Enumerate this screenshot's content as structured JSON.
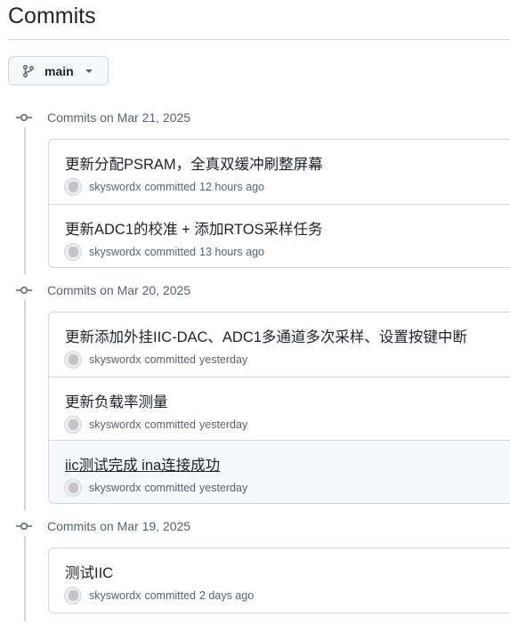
{
  "page": {
    "title": "Commits"
  },
  "branch": {
    "label": "main"
  },
  "groups": [
    {
      "label": "Commits on Mar 21, 2025",
      "commits": [
        {
          "title": "更新分配PSRAM，全真双缓冲刷整屏幕",
          "author": "skyswordx",
          "action": "committed",
          "time": "12 hours ago"
        },
        {
          "title": "更新ADC1的校准 + 添加RTOS采样任务",
          "author": "skyswordx",
          "action": "committed",
          "time": "13 hours ago"
        }
      ]
    },
    {
      "label": "Commits on Mar 20, 2025",
      "commits": [
        {
          "title": "更新添加外挂IIC-DAC、ADC1多通道多次采样、设置按键中断",
          "author": "skyswordx",
          "action": "committed",
          "time": "yesterday"
        },
        {
          "title": "更新负载率测量",
          "author": "skyswordx",
          "action": "committed",
          "time": "yesterday"
        },
        {
          "title": "iic测试完成 ina连接成功",
          "author": "skyswordx",
          "action": "committed",
          "time": "yesterday"
        }
      ]
    },
    {
      "label": "Commits on Mar 19, 2025",
      "commits": [
        {
          "title": "测试IIC",
          "author": "skyswordx",
          "action": "committed",
          "time": "2 days ago"
        }
      ]
    }
  ],
  "icons": {
    "branch": "git-branch-icon",
    "caret": "chevron-down-icon",
    "node": "git-commit-icon",
    "avatar": "user-avatar"
  },
  "colors": {
    "border": "#d0d7de",
    "muted": "#59636e",
    "hover_bg": "#f6f8fa"
  }
}
